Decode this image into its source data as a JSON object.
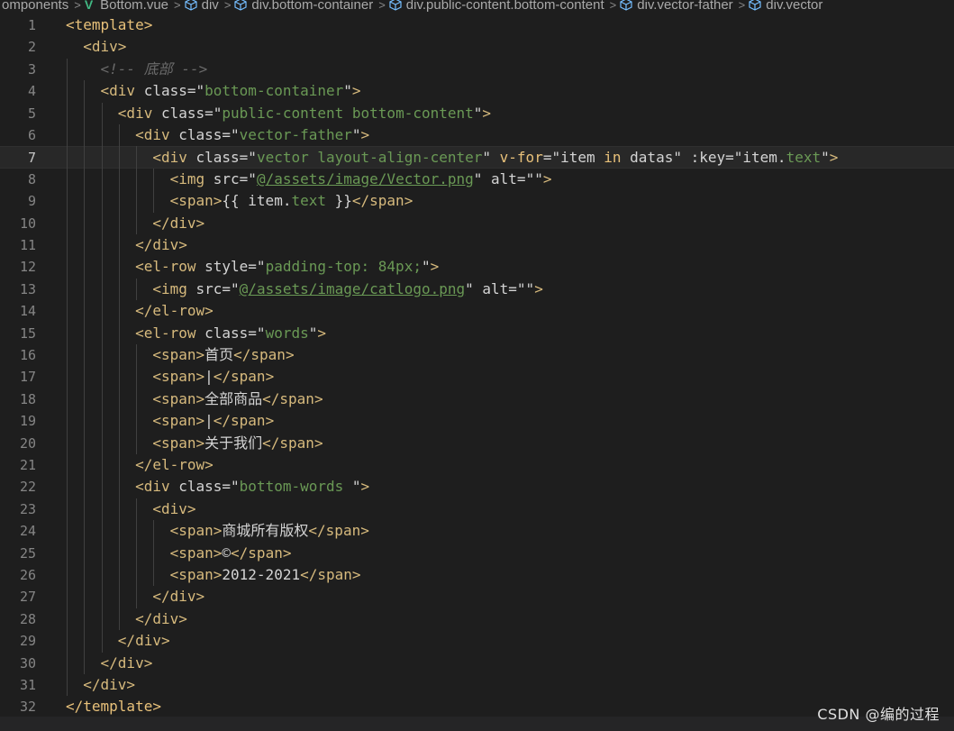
{
  "breadcrumb": {
    "items": [
      {
        "label": "omponents",
        "icon": null
      },
      {
        "label": "Bottom.vue",
        "icon": "vue-icon"
      },
      {
        "label": "div",
        "icon": "cube-icon"
      },
      {
        "label": "div.bottom-container",
        "icon": "cube-icon"
      },
      {
        "label": "div.public-content.bottom-content",
        "icon": "cube-icon"
      },
      {
        "label": "div.vector-father",
        "icon": "cube-icon"
      },
      {
        "label": "div.vector",
        "icon": "cube-icon"
      }
    ],
    "separator": ">"
  },
  "editor": {
    "active_line": 7,
    "lines": [
      {
        "n": "1",
        "tokens": [
          [
            "t-tag",
            "<template>"
          ]
        ]
      },
      {
        "n": "2",
        "tokens": [
          [
            "tag",
            "  <div>"
          ]
        ]
      },
      {
        "n": "3",
        "tokens": [
          [
            "cmt",
            "    <!-- 底部 -->"
          ]
        ]
      },
      {
        "n": "4",
        "tokens": [
          [
            "tag",
            "    <div "
          ],
          [
            "attr",
            "class="
          ],
          [
            "strq",
            "\""
          ],
          [
            "str",
            "bottom-container"
          ],
          [
            "strq",
            "\""
          ],
          [
            "tag",
            ">"
          ]
        ]
      },
      {
        "n": "5",
        "tokens": [
          [
            "tag",
            "      <div "
          ],
          [
            "attr",
            "class="
          ],
          [
            "strq",
            "\""
          ],
          [
            "str",
            "public-content bottom-content"
          ],
          [
            "strq",
            "\""
          ],
          [
            "tag",
            ">"
          ]
        ]
      },
      {
        "n": "6",
        "tokens": [
          [
            "tag",
            "        <div "
          ],
          [
            "attr",
            "class="
          ],
          [
            "strq",
            "\""
          ],
          [
            "str",
            "vector-father"
          ],
          [
            "strq",
            "\""
          ],
          [
            "tag",
            ">"
          ]
        ]
      },
      {
        "n": "7",
        "tokens": [
          [
            "tag",
            "          <div "
          ],
          [
            "attr",
            "class="
          ],
          [
            "strq",
            "\""
          ],
          [
            "str",
            "vector layout-align-center"
          ],
          [
            "strq",
            "\" "
          ],
          [
            "kw",
            "v-for"
          ],
          [
            "attr",
            "="
          ],
          [
            "strq",
            "\"item "
          ],
          [
            "kw",
            "in"
          ],
          [
            "strq",
            " datas\" "
          ],
          [
            "attr",
            ":key="
          ],
          [
            "strq",
            "\"item."
          ],
          [
            "str",
            "text"
          ],
          [
            "strq",
            "\""
          ],
          [
            "tag",
            ">"
          ]
        ]
      },
      {
        "n": "8",
        "tokens": [
          [
            "tag",
            "            <img "
          ],
          [
            "attr",
            "src="
          ],
          [
            "strq",
            "\""
          ],
          [
            "str",
            "@/assets/image/Vector.png"
          ],
          [
            "strq",
            "\" "
          ],
          [
            "attr",
            "alt="
          ],
          [
            "strq",
            "\"\""
          ],
          [
            "tag",
            ">"
          ]
        ]
      },
      {
        "n": "9",
        "tokens": [
          [
            "tag",
            "            <span>"
          ],
          [
            "ptxt",
            "{{ item."
          ],
          [
            "str",
            "text"
          ],
          [
            "ptxt",
            " }}"
          ],
          [
            "tag",
            "</span>"
          ]
        ]
      },
      {
        "n": "10",
        "tokens": [
          [
            "tag",
            "          </div>"
          ]
        ]
      },
      {
        "n": "11",
        "tokens": [
          [
            "tag",
            "        </div>"
          ]
        ]
      },
      {
        "n": "12",
        "tokens": [
          [
            "tag",
            "        <el-row "
          ],
          [
            "attr",
            "style="
          ],
          [
            "strq",
            "\""
          ],
          [
            "str",
            "padding-top: 84px;"
          ],
          [
            "strq",
            "\""
          ],
          [
            "tag",
            ">"
          ]
        ]
      },
      {
        "n": "13",
        "tokens": [
          [
            "tag",
            "          <img "
          ],
          [
            "attr",
            "src="
          ],
          [
            "strq",
            "\""
          ],
          [
            "str",
            "@/assets/image/catlogo.png"
          ],
          [
            "strq",
            "\" "
          ],
          [
            "attr",
            "alt="
          ],
          [
            "strq",
            "\"\""
          ],
          [
            "tag",
            ">"
          ]
        ]
      },
      {
        "n": "14",
        "tokens": [
          [
            "tag",
            "        </el-row>"
          ]
        ]
      },
      {
        "n": "15",
        "tokens": [
          [
            "tag",
            "        <el-row "
          ],
          [
            "attr",
            "class="
          ],
          [
            "strq",
            "\""
          ],
          [
            "str",
            "words"
          ],
          [
            "strq",
            "\""
          ],
          [
            "tag",
            ">"
          ]
        ]
      },
      {
        "n": "16",
        "tokens": [
          [
            "tag",
            "          <span>"
          ],
          [
            "ptxt",
            "首页"
          ],
          [
            "tag",
            "</span>"
          ]
        ]
      },
      {
        "n": "17",
        "tokens": [
          [
            "tag",
            "          <span>"
          ],
          [
            "ptxt",
            "|"
          ],
          [
            "tag",
            "</span>"
          ]
        ]
      },
      {
        "n": "18",
        "tokens": [
          [
            "tag",
            "          <span>"
          ],
          [
            "ptxt",
            "全部商品"
          ],
          [
            "tag",
            "</span>"
          ]
        ]
      },
      {
        "n": "19",
        "tokens": [
          [
            "tag",
            "          <span>"
          ],
          [
            "ptxt",
            "|"
          ],
          [
            "tag",
            "</span>"
          ]
        ]
      },
      {
        "n": "20",
        "tokens": [
          [
            "tag",
            "          <span>"
          ],
          [
            "ptxt",
            "关于我们"
          ],
          [
            "tag",
            "</span>"
          ]
        ]
      },
      {
        "n": "21",
        "tokens": [
          [
            "tag",
            "        </el-row>"
          ]
        ]
      },
      {
        "n": "22",
        "tokens": [
          [
            "tag",
            "        <div "
          ],
          [
            "attr",
            "class="
          ],
          [
            "strq",
            "\""
          ],
          [
            "str",
            "bottom-words"
          ],
          [
            "strq",
            " \""
          ],
          [
            "tag",
            ">"
          ]
        ]
      },
      {
        "n": "23",
        "tokens": [
          [
            "tag",
            "          <div>"
          ]
        ]
      },
      {
        "n": "24",
        "tokens": [
          [
            "tag",
            "            <span>"
          ],
          [
            "ptxt",
            "商城所有版权"
          ],
          [
            "tag",
            "</span>"
          ]
        ]
      },
      {
        "n": "25",
        "tokens": [
          [
            "tag",
            "            <span>"
          ],
          [
            "ptxt",
            "©"
          ],
          [
            "tag",
            "</span>"
          ]
        ]
      },
      {
        "n": "26",
        "tokens": [
          [
            "tag",
            "            <span>"
          ],
          [
            "ptxt",
            "2012-2021"
          ],
          [
            "tag",
            "</span>"
          ]
        ]
      },
      {
        "n": "27",
        "tokens": [
          [
            "tag",
            "          </div>"
          ]
        ]
      },
      {
        "n": "28",
        "tokens": [
          [
            "tag",
            "        </div>"
          ]
        ]
      },
      {
        "n": "29",
        "tokens": [
          [
            "tag",
            "      </div>"
          ]
        ]
      },
      {
        "n": "30",
        "tokens": [
          [
            "tag",
            "    </div>"
          ]
        ]
      },
      {
        "n": "31",
        "tokens": [
          [
            "tag",
            "  </div>"
          ]
        ]
      },
      {
        "n": "32",
        "tokens": [
          [
            "t-tag",
            "</template>"
          ]
        ]
      }
    ]
  },
  "watermark": "CSDN @编的过程",
  "colors": {
    "background": "#1e1e1e",
    "tag": "#d7ba7d",
    "string": "#6a9955",
    "comment": "#6a6a6a",
    "line_number": "#858585"
  }
}
